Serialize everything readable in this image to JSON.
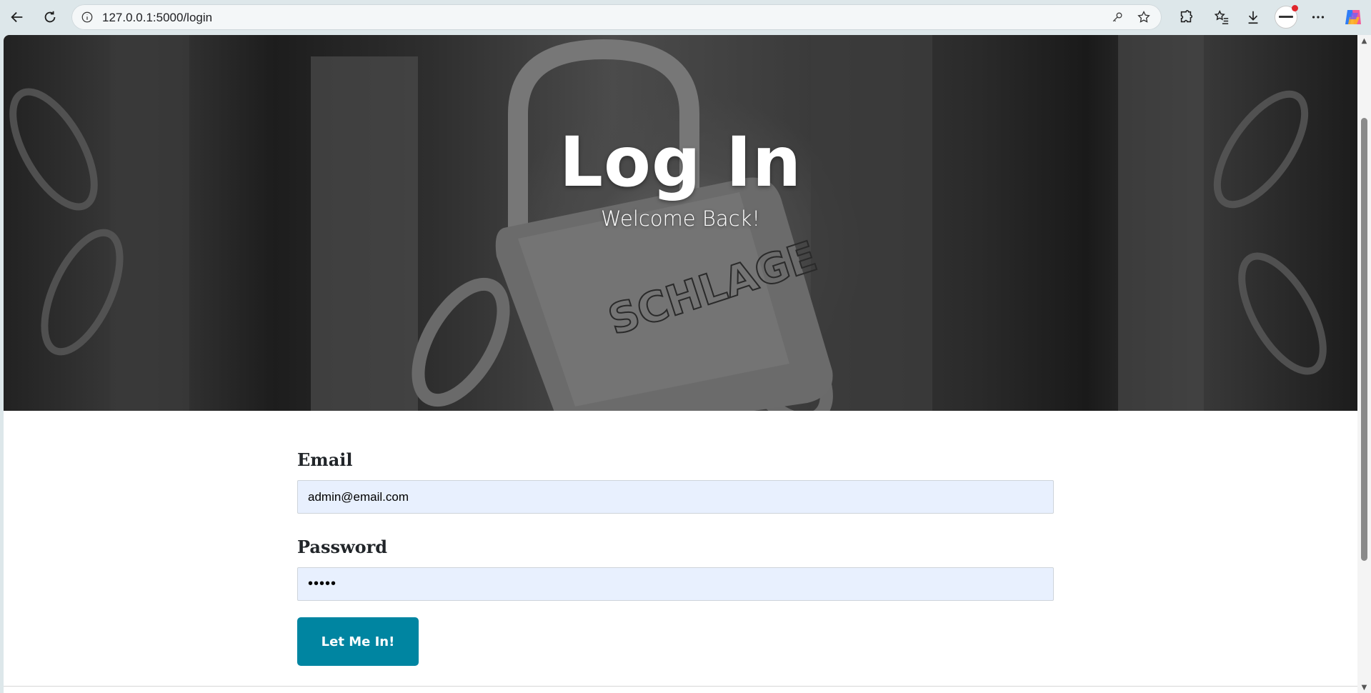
{
  "browser": {
    "url": "127.0.0.1:5000/login",
    "back_icon": "back-arrow-icon",
    "reload_icon": "reload-icon",
    "site_info_icon": "info-icon",
    "password_icon": "key-icon",
    "favorite_icon": "star-icon",
    "extensions_icon": "puzzle-icon",
    "favorites_icon": "favorites-list-icon",
    "downloads_icon": "download-icon",
    "menu_icon": "more-icon",
    "copilot_icon": "copilot-icon"
  },
  "hero": {
    "title": "Log In",
    "subtitle": "Welcome Back!"
  },
  "form": {
    "email_label": "Email",
    "email_value": "admin@email.com",
    "password_label": "Password",
    "password_value": "•••••",
    "submit_label": "Let Me In!"
  },
  "colors": {
    "button": "#0085a1",
    "input_background": "#e8f0fe",
    "chrome_background": "#dde7ea"
  }
}
